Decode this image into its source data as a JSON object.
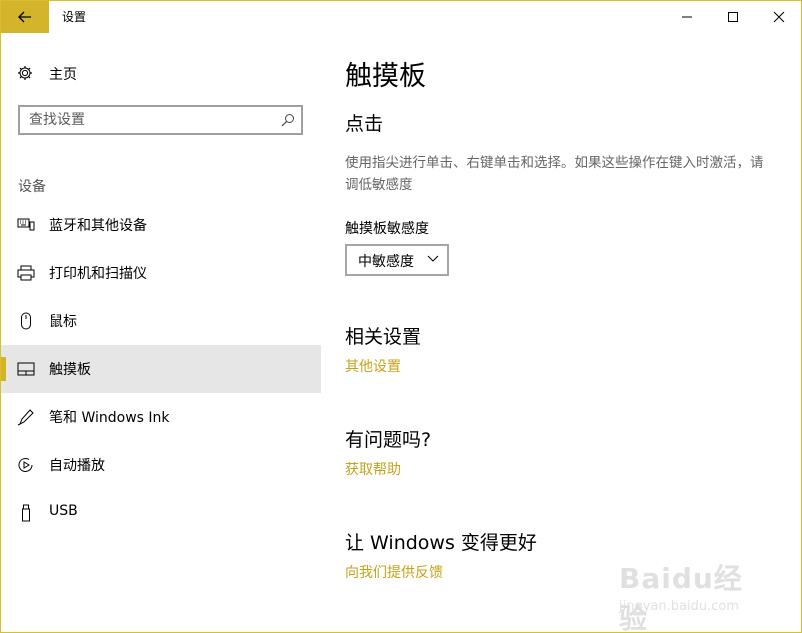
{
  "window": {
    "title": "设置",
    "accent": "#d4b42a"
  },
  "sidebar": {
    "home_label": "主页",
    "search_placeholder": "查找设置",
    "section_label": "设备",
    "items": [
      {
        "label": "蓝牙和其他设备",
        "icon": "bluetooth-devices-icon"
      },
      {
        "label": "打印机和扫描仪",
        "icon": "printer-icon"
      },
      {
        "label": "鼠标",
        "icon": "mouse-icon"
      },
      {
        "label": "触摸板",
        "icon": "touchpad-icon",
        "selected": true
      },
      {
        "label": "笔和 Windows Ink",
        "icon": "pen-icon"
      },
      {
        "label": "自动播放",
        "icon": "autoplay-icon"
      },
      {
        "label": "USB",
        "icon": "usb-icon"
      }
    ]
  },
  "main": {
    "title": "触摸板",
    "click_section": {
      "title": "点击",
      "description": "使用指尖进行单击、右键单击和选择。如果这些操作在键入时激活，请调低敏感度",
      "sensitivity_label": "触摸板敏感度",
      "sensitivity_value": "中敏感度"
    },
    "related": {
      "title": "相关设置",
      "link": "其他设置"
    },
    "help": {
      "title": "有问题吗?",
      "link": "获取帮助"
    },
    "feedback": {
      "title": "让 Windows 变得更好",
      "link": "向我们提供反馈"
    }
  },
  "watermark": {
    "logo": "Baidu经验",
    "url": "jingyan.baidu.com"
  }
}
